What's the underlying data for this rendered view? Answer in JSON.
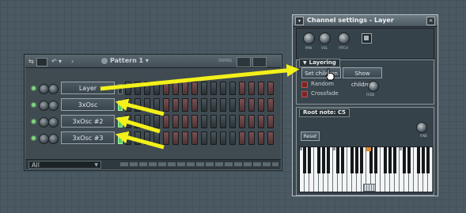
{
  "pattern_window": {
    "title": "Pattern 1",
    "swing_label": "SWING",
    "channels": [
      {
        "name": "Layer",
        "selected": false
      },
      {
        "name": "3xOsc",
        "selected": true
      },
      {
        "name": "3xOsc #2",
        "selected": true
      },
      {
        "name": "3xOsc #3",
        "selected": true
      }
    ],
    "filter": "All"
  },
  "channel_settings": {
    "title": "Channel settings - Layer",
    "knob_labels": [
      "PAN",
      "VOL",
      "PITCH"
    ],
    "layering": {
      "heading": "Layering",
      "set_children": "Set children",
      "show_children": "Show children",
      "random": "Random",
      "crossfade": "Crossfade",
      "fade_label": "FADE"
    },
    "root_note": {
      "heading": "Root note: C5",
      "reset": "Reset",
      "fine_label": "FINE"
    }
  },
  "colors": {
    "arrow": "#f3f01a",
    "step_gray": "#3a4348",
    "step_red": "#6a4244",
    "led_green": "#7cd67a"
  }
}
